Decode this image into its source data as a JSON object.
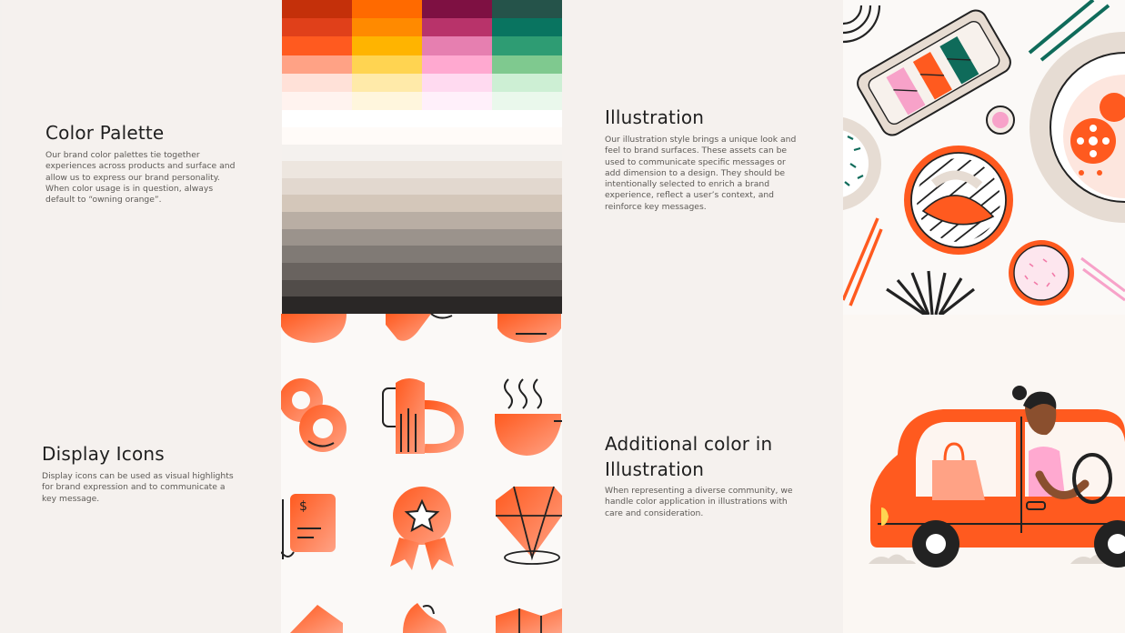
{
  "colors": {
    "accent": "#ff5a1f",
    "panel_bg": "#f5f1ee",
    "text_heading": "#1f1f1f",
    "text_body": "#5c5955"
  },
  "sections": {
    "color_palette": {
      "title": "Color Palette",
      "body": "Our brand color palettes tie together experiences across products and surface and allow us to express our brand personality. When color usage is in question, always default to “owning orange”."
    },
    "illustration": {
      "title": "Illustration",
      "body": "Our illustration style brings a unique look and feel to brand surfaces. These assets can be used to communicate specific messages or add dimension to a design. They should be intentionally selected to enrich a brand experience, reflect a user’s context, and reinforce key messages."
    },
    "display_icons": {
      "title": "Display Icons",
      "body": "Display icons can be used as visual highlights for brand expression and to communicate a key message."
    },
    "additional_color": {
      "title_line1": "Additional color in",
      "title_line2": "Illustration",
      "body": "When representing a diverse community, we handle color application in illustrations with care and consideration."
    }
  },
  "palette": {
    "columns": [
      [
        "#c4300a",
        "#e0401a",
        "#ff5a1f",
        "#ffa285",
        "#ffe1d8",
        "#fff3ef"
      ],
      [
        "#ff6a00",
        "#ff8a00",
        "#ffb400",
        "#ffd451",
        "#ffeaa9",
        "#fff6dd"
      ],
      [
        "#7e1042",
        "#b8336a",
        "#e67fb0",
        "#ffa9d0",
        "#ffdaf0",
        "#fff0fa"
      ],
      [
        "#25534a",
        "#097460",
        "#2e9c73",
        "#7fc98f",
        "#cdefd4",
        "#eaf8ec"
      ]
    ],
    "neutrals": [
      "#ffffff",
      "#fffbf8",
      "#f4f1ee",
      "#ede6df",
      "#e2d8cf",
      "#d4c7ba",
      "#b9aea4",
      "#9b938c",
      "#807a75",
      "#69635f",
      "#514c49",
      "#2a2726"
    ]
  },
  "icons": {
    "row1": [
      "bowl-icon",
      "heart-hand-icon",
      "lamp-icon"
    ],
    "row2": [
      "donut-icon",
      "beer-mug-icon",
      "coffee-cup-icon"
    ],
    "row3": [
      "receipt-icon",
      "award-ribbon-icon",
      "diamond-icon"
    ],
    "row4": [
      "map-pin-icon",
      "flame-icon",
      "map-icon"
    ]
  }
}
